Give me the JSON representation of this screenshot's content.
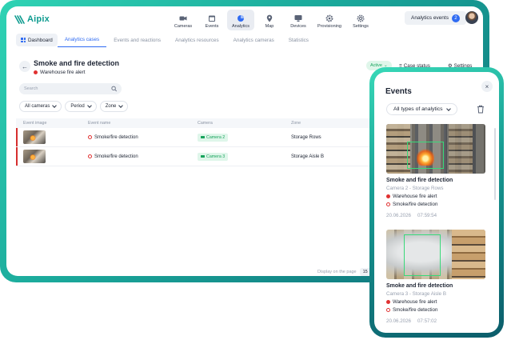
{
  "app": {
    "name": "Aipix"
  },
  "nav": [
    {
      "label": "Cameras",
      "icon": "camera-icon"
    },
    {
      "label": "Events",
      "icon": "calendar-icon"
    },
    {
      "label": "Analytics",
      "icon": "pie-chart-icon",
      "active": true
    },
    {
      "label": "Map",
      "icon": "map-pin-icon"
    },
    {
      "label": "Devices",
      "icon": "monitor-icon"
    },
    {
      "label": "Provisioning",
      "icon": "gear-icon"
    },
    {
      "label": "Settings",
      "icon": "settings-icon"
    }
  ],
  "header": {
    "events_label": "Analytics events",
    "events_count": "2"
  },
  "subnav": {
    "dashboard": "Dashboard",
    "tabs": [
      "Analytics cases",
      "Events and reactions",
      "Analytics resources",
      "Analytics cameras",
      "Statistics"
    ],
    "active_tab": 0
  },
  "case": {
    "title": "Smoke and fire detection",
    "subtitle": "Warehouse fire alert",
    "status": "Active",
    "case_status_label": "Case status",
    "settings_label": "Settings"
  },
  "search": {
    "placeholder": "Search"
  },
  "filters": [
    "All cameras",
    "Period",
    "Zone"
  ],
  "table": {
    "headers": [
      "Event image",
      "Event name",
      "Camera",
      "Zone"
    ],
    "rows": [
      {
        "event": "Smoke/fire detection",
        "camera": "Camera 2",
        "zone": "Storage Rows"
      },
      {
        "event": "Smoke/fire detection",
        "camera": "Camera 3",
        "zone": "Storage Aisle B"
      }
    ]
  },
  "pager": {
    "label": "Display on the page",
    "value": "15"
  },
  "events_panel": {
    "title": "Events",
    "filter": "All types of analytics",
    "items": [
      {
        "title": "Smoke and fire detection",
        "meta": "Camera 2 - Storage Rows",
        "alert": "Warehouse fire alert",
        "event": "Smoke/fire detection",
        "date": "20.06.2026",
        "time": "07:59:54"
      },
      {
        "title": "Smoke and fire detection",
        "meta": "Camera 3 - Storage Aisle B",
        "alert": "Warehouse fire alert",
        "event": "Smoke/fire detection",
        "date": "20.06.2026",
        "time": "07:57:02"
      }
    ]
  },
  "colors": {
    "accent": "#2f6bf2",
    "brand": "#0d9b8f",
    "alert": "#e03131",
    "success": "#18a35c"
  }
}
